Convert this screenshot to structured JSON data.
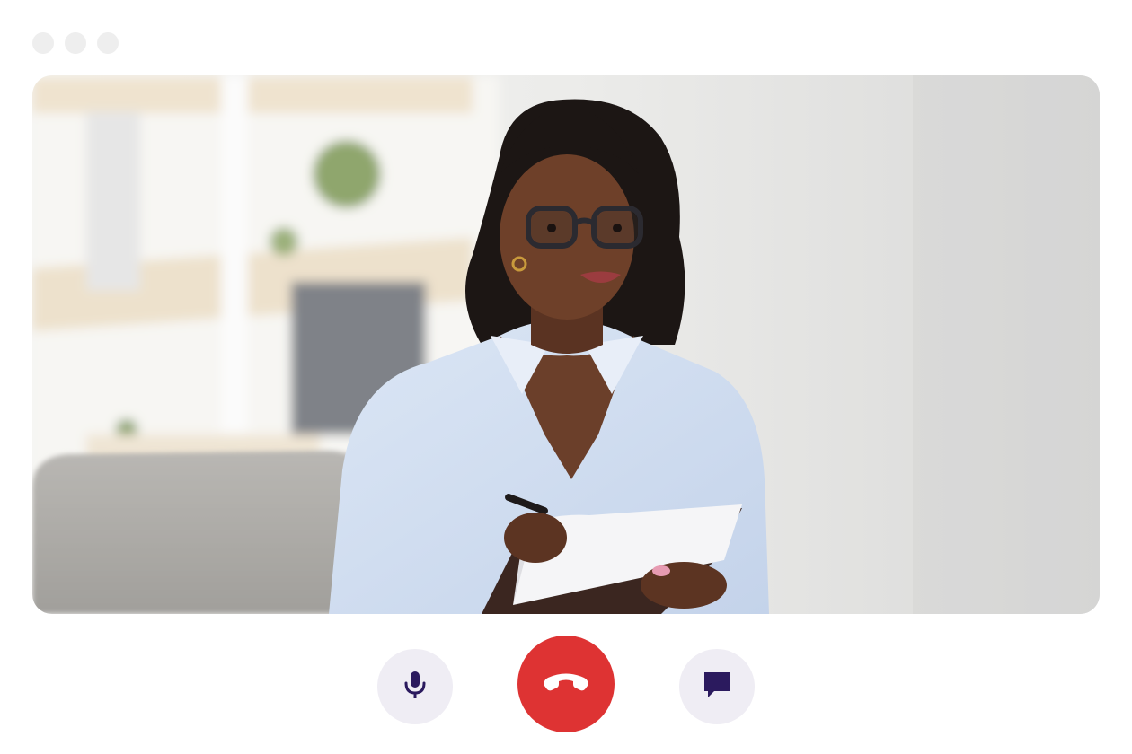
{
  "window": {
    "controls": [
      "window-dot",
      "window-dot",
      "window-dot"
    ]
  },
  "video_call": {
    "feed": "participant-video",
    "controls": {
      "mic": {
        "icon": "microphone-icon",
        "color": "#2b1a5e"
      },
      "end_call": {
        "icon": "phone-hangup-icon",
        "color": "#de3333"
      },
      "chat": {
        "icon": "chat-bubble-icon",
        "color": "#2b1a5e"
      }
    }
  }
}
